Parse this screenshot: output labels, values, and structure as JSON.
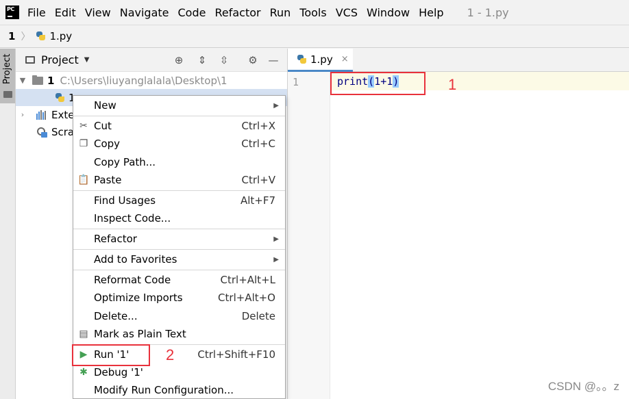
{
  "menubar": {
    "app_icon": "pycharm-logo",
    "app_icon_text": "PC",
    "items": [
      "File",
      "Edit",
      "View",
      "Navigate",
      "Code",
      "Refactor",
      "Run",
      "Tools",
      "VCS",
      "Window",
      "Help"
    ],
    "window_title": "1 - 1.py"
  },
  "navbar": {
    "root": "1",
    "separator": "〉",
    "file": "1.py"
  },
  "tool_strip": {
    "project_label": "Project"
  },
  "project_panel": {
    "title": "Project",
    "tree": {
      "root_name": "1",
      "root_path": "C:\\Users\\liuyanglalala\\Desktop\\1",
      "file_visible_text": "1",
      "external_visible_text": "Exte",
      "scratch_visible_text": "Scra"
    }
  },
  "editor": {
    "tab_label": "1.py",
    "tab_close": "×",
    "line_number": "1",
    "code_prefix": "print",
    "code_open_paren": "(",
    "code_args": "1+1",
    "code_close_paren": ")",
    "annotation_1": "1"
  },
  "context_menu": {
    "items": [
      {
        "label": "New",
        "shortcut": "",
        "submenu": true
      },
      {
        "label": "Cut",
        "shortcut": "Ctrl+X",
        "icon": "scissors-icon"
      },
      {
        "label": "Copy",
        "shortcut": "Ctrl+C",
        "icon": "copy-icon"
      },
      {
        "label": "Copy Path...",
        "shortcut": ""
      },
      {
        "label": "Paste",
        "shortcut": "Ctrl+V",
        "icon": "clipboard-icon"
      },
      {
        "label": "Find Usages",
        "shortcut": "Alt+F7"
      },
      {
        "label": "Inspect Code...",
        "shortcut": ""
      },
      {
        "label": "Refactor",
        "shortcut": "",
        "submenu": true
      },
      {
        "label": "Add to Favorites",
        "shortcut": "",
        "submenu": true
      },
      {
        "label": "Reformat Code",
        "shortcut": "Ctrl+Alt+L"
      },
      {
        "label": "Optimize Imports",
        "shortcut": "Ctrl+Alt+O"
      },
      {
        "label": "Delete...",
        "shortcut": "Delete"
      },
      {
        "label": "Mark as Plain Text",
        "shortcut": "",
        "icon": "plain-text-icon"
      },
      {
        "label": "Run '1'",
        "shortcut": "Ctrl+Shift+F10",
        "icon": "run-icon"
      },
      {
        "label": "Debug '1'",
        "shortcut": "",
        "icon": "debug-icon"
      },
      {
        "label": "Modify Run Configuration...",
        "shortcut": ""
      }
    ],
    "annotation_2": "2"
  },
  "watermark": "CSDN @。。z",
  "colors": {
    "annotation_red": "#e8313b",
    "run_green": "#45a054",
    "selection_blue": "#d5e1f2",
    "code_blue": "#000080"
  }
}
